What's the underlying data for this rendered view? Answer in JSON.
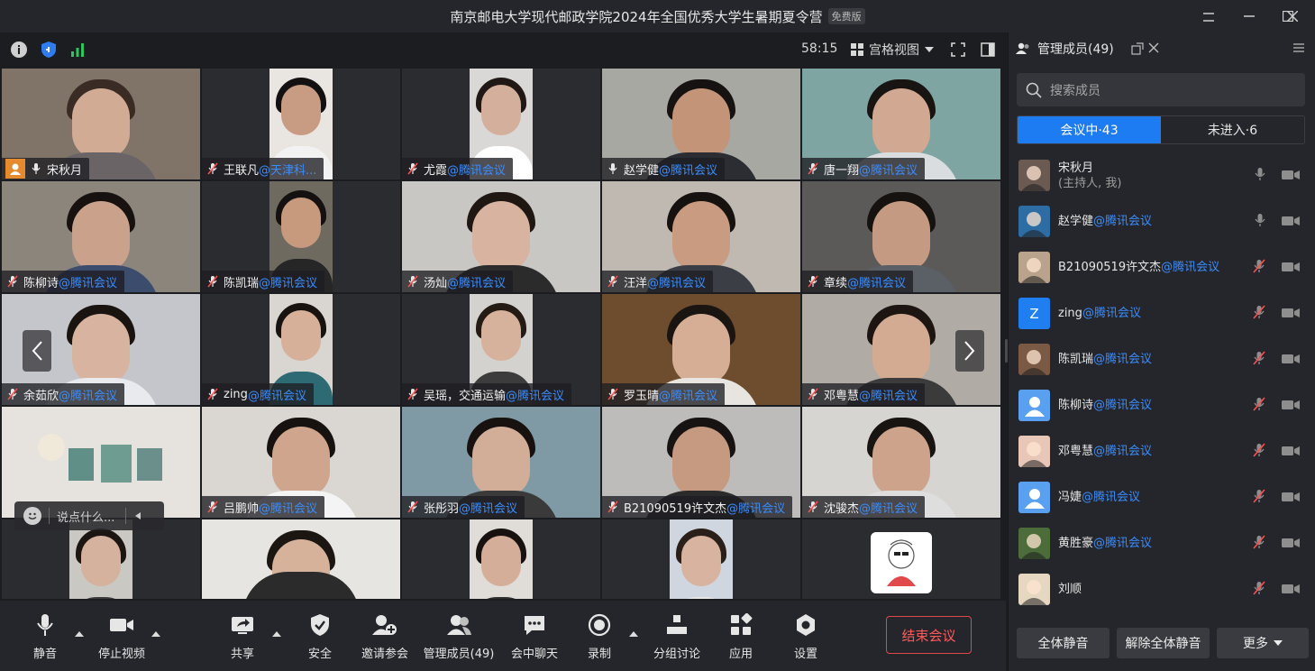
{
  "window": {
    "title": "南京邮电大学现代邮政学院2024年全国优秀大学生暑期夏令营",
    "badge": "免费版"
  },
  "topbar": {
    "timer": "58:15",
    "view_label": "宫格视图"
  },
  "tiles": [
    {
      "name": "宋秋月",
      "org": "",
      "host": true,
      "muted": false,
      "bg": "#7f7467",
      "skin": "#d2ab95",
      "hair": "#3a2c24",
      "shirt": "#6a6466"
    },
    {
      "name": "王联凡",
      "org": "@天津科...",
      "muted": true,
      "bg": "#2b2c30",
      "panel": "#e9e6e1",
      "skin": "#c89c82",
      "hair": "#121010",
      "shirt": "#f2f2f2"
    },
    {
      "name": "尤霞",
      "org": "@腾讯会议",
      "muted": true,
      "bg": "#2b2c30",
      "panel": "#d9d8d6",
      "skin": "#d4b09c",
      "hair": "#201814",
      "shirt": "#ffffff"
    },
    {
      "name": "赵学健",
      "org": "@腾讯会议",
      "muted": false,
      "bg": "#a8a8a2",
      "skin": "#c49479",
      "hair": "#151211",
      "shirt": "#2b2d33"
    },
    {
      "name": "唐一翔",
      "org": "@腾讯会议",
      "muted": true,
      "bg": "#7fa5a2",
      "skin": "#d1a891",
      "hair": "#181412",
      "shirt": "#d9dde0"
    },
    {
      "name": "陈柳诗",
      "org": "@腾讯会议",
      "muted": true,
      "bg": "#8c857c",
      "skin": "#caa18a",
      "hair": "#17120f",
      "shirt": "#3c4c6c"
    },
    {
      "name": "陈凯瑞",
      "org": "@腾讯会议",
      "muted": true,
      "bg": "#2b2c30",
      "panel": "#6f6a60",
      "skin": "#c79a7e",
      "hair": "#141110",
      "shirt": "#262626"
    },
    {
      "name": "汤灿",
      "org": "@腾讯会议",
      "muted": true,
      "bg": "#c9c7c4",
      "skin": "#d7b3a0",
      "hair": "#1e1712",
      "shirt": "#2b2b2b"
    },
    {
      "name": "汪洋",
      "org": "@腾讯会议",
      "muted": true,
      "bg": "#bfb9b1",
      "skin": "#c99b80",
      "hair": "#151210",
      "shirt": "#3b3f45"
    },
    {
      "name": "章续",
      "org": "@腾讯会议",
      "muted": true,
      "bg": "#5b5a58",
      "skin": "#c59a82",
      "hair": "#151210",
      "shirt": "#5b5f66"
    },
    {
      "name": "余茹欣",
      "org": "@腾讯会议",
      "muted": true,
      "bg": "#c5c6cc",
      "skin": "#d8b4a0",
      "hair": "#1a1411",
      "shirt": "#e9eaee"
    },
    {
      "name": "zing",
      "org": "@腾讯会议",
      "muted": true,
      "bg": "#2b2c30",
      "panel": "#d9d6d2",
      "skin": "#d7b09a",
      "hair": "#181310",
      "shirt": "#2d6a74"
    },
    {
      "name": "吴瑶，交通运输",
      "org": "@腾讯会议",
      "muted": true,
      "bg": "#2b2c30",
      "panel": "#d4d2cf",
      "skin": "#d6b19b",
      "hair": "#251b15",
      "shirt": "#3c3c3c"
    },
    {
      "name": "罗玉晴",
      "org": "@腾讯会议",
      "muted": true,
      "bg": "#6d4d2d",
      "skin": "#d5ae95",
      "hair": "#1b1512",
      "shirt": "#e8e4df"
    },
    {
      "name": "邓粤慧",
      "org": "@腾讯会议",
      "muted": true,
      "bg": "#b1aba5",
      "skin": "#d2ab92",
      "hair": "#1c1512",
      "shirt": "#3b3b3b"
    },
    {
      "name": "",
      "org": "",
      "muted": true,
      "bg": "#e6e3de",
      "skin": "#e6e3de",
      "hair": "#e6e3de",
      "shirt": "#e6e3de",
      "art": true
    },
    {
      "name": "吕鹏帅",
      "org": "@腾讯会议",
      "muted": true,
      "bg": "#dad7d2",
      "skin": "#cfa68d",
      "hair": "#161210",
      "shirt": "#f4f4f4"
    },
    {
      "name": "张彤羽",
      "org": "@腾讯会议",
      "muted": true,
      "bg": "#7f9aa5",
      "skin": "#d2ad98",
      "hair": "#171210",
      "shirt": "#3a3a3a"
    },
    {
      "name": "B21090519许文杰",
      "org": "@腾讯会议",
      "muted": true,
      "bg": "#bdbcba",
      "skin": "#c59a80",
      "hair": "#171312",
      "shirt": "#2b2b2b"
    },
    {
      "name": "沈骏杰",
      "org": "@腾讯会议",
      "muted": true,
      "bg": "#d7d5d1",
      "skin": "#cda48b",
      "hair": "#181412",
      "shirt": "#dedede"
    },
    {
      "name": "",
      "org": "",
      "muted": true,
      "bg": "#2b2c30",
      "panel": "#c9c8c3",
      "skin": "#d5b29d",
      "hair": "#1c1613",
      "shirt": "#3c3c3c",
      "nolabel": true
    },
    {
      "name": "",
      "org": "",
      "muted": true,
      "bg": "#e7e5e1",
      "skin": "#d7b29b",
      "hair": "#1c1613",
      "shirt": "#2b2b2b",
      "nolabel": true
    },
    {
      "name": "",
      "org": "",
      "muted": true,
      "bg": "#2b2c30",
      "panel": "#e0ddd8",
      "skin": "#d4ae98",
      "hair": "#171210",
      "shirt": "#2f2f2f",
      "nolabel": true
    },
    {
      "name": "",
      "org": "",
      "muted": true,
      "bg": "#2b2c30",
      "panel": "#cfd6df",
      "skin": "#d7b3a0",
      "hair": "#2a1f19",
      "shirt": "#e6e6e6",
      "nolabel": true
    },
    {
      "name": "",
      "org": "",
      "muted": true,
      "bg": "#2b2c30",
      "cartoon": true,
      "nolabel": true
    }
  ],
  "chat": {
    "placeholder": "说点什么..."
  },
  "controls": [
    {
      "label": "静音",
      "icon": "mic-icon",
      "caret": true
    },
    {
      "label": "停止视频",
      "icon": "video-camera-icon",
      "caret": true
    },
    {
      "label": "共享",
      "icon": "share-screen-icon",
      "caret": true
    },
    {
      "label": "安全",
      "icon": "shield-icon",
      "caret": false
    },
    {
      "label": "邀请参会",
      "icon": "invite-user-icon",
      "caret": false
    },
    {
      "label": "管理成员(49)",
      "icon": "members-icon",
      "caret": false
    },
    {
      "label": "会中聊天",
      "icon": "chat-icon",
      "caret": false
    },
    {
      "label": "录制",
      "icon": "record-icon",
      "caret": true
    },
    {
      "label": "分组讨论",
      "icon": "breakout-icon",
      "caret": false
    },
    {
      "label": "应用",
      "icon": "apps-icon",
      "caret": false
    },
    {
      "label": "设置",
      "icon": "settings-icon",
      "caret": false
    }
  ],
  "end_button": "结束会议",
  "panel": {
    "title": "管理成员(49)",
    "search_placeholder": "搜索成员",
    "tab_in": "会议中·43",
    "tab_out": "未进入·6",
    "members": [
      {
        "name": "宋秋月",
        "org": "",
        "sub": "(主持人, 我)",
        "mic": "on",
        "avatar": "photo",
        "color": "#6a5a52"
      },
      {
        "name": "赵学健",
        "org": "@腾讯会议",
        "sub": "",
        "mic": "on",
        "avatar": "photo",
        "color": "#2d6da3"
      },
      {
        "name": "B21090519许文杰",
        "org": "@腾讯会议",
        "sub": "",
        "mic": "off",
        "avatar": "photo",
        "color": "#b9a38c"
      },
      {
        "name": "zing",
        "org": "@腾讯会议",
        "sub": "",
        "mic": "off",
        "avatar": "letter",
        "letter": "Z",
        "color": "#1f7ef0"
      },
      {
        "name": "陈凯瑞",
        "org": "@腾讯会议",
        "sub": "",
        "mic": "off",
        "avatar": "photo",
        "color": "#7a5a45"
      },
      {
        "name": "陈柳诗",
        "org": "@腾讯会议",
        "sub": "",
        "mic": "off",
        "avatar": "default",
        "color": "#5aa0f0"
      },
      {
        "name": "邓粤慧",
        "org": "@腾讯会议",
        "sub": "",
        "mic": "off",
        "avatar": "photo",
        "color": "#e8c7b8"
      },
      {
        "name": "冯婕",
        "org": "@腾讯会议",
        "sub": "",
        "mic": "off",
        "avatar": "default",
        "color": "#5aa0f0"
      },
      {
        "name": "黄胜豪",
        "org": "@腾讯会议",
        "sub": "",
        "mic": "off",
        "avatar": "photo",
        "color": "#4c6d3a"
      },
      {
        "name": "刘顺",
        "org": "",
        "sub": "",
        "mic": "off",
        "avatar": "photo",
        "color": "#e5d7c0"
      }
    ],
    "btn_mute_all": "全体静音",
    "btn_unmute_all": "解除全体静音",
    "btn_more": "更多"
  },
  "colors": {
    "accent": "#1e7cf2",
    "org_blue": "#3a8dff",
    "end_red": "#ff5a5a"
  }
}
